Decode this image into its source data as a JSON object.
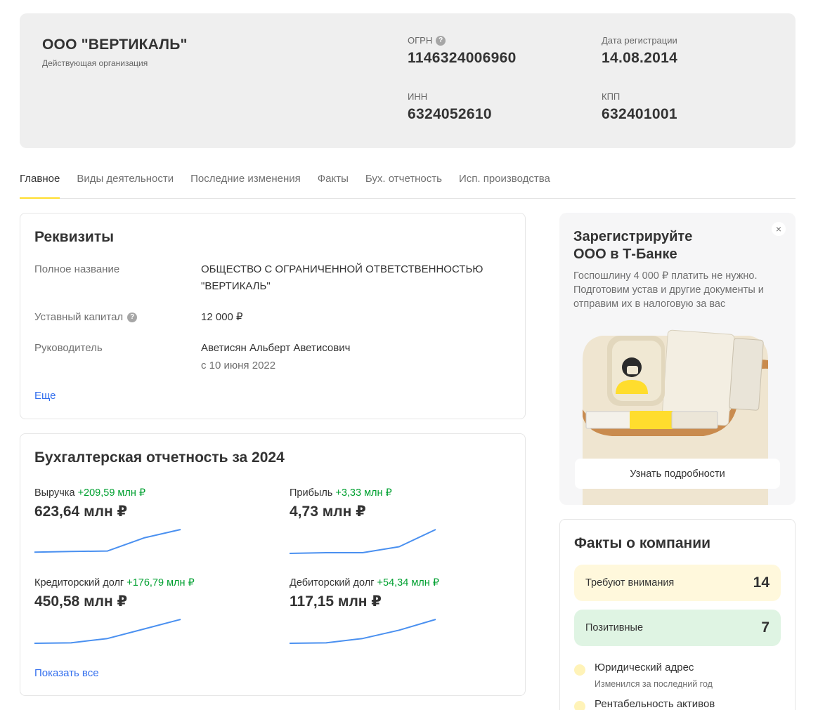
{
  "company": {
    "name": "ООО \"ВЕРТИКАЛЬ\"",
    "status": "Действующая организация",
    "ogrn_label": "ОГРН",
    "ogrn": "1146324006960",
    "reg_date_label": "Дата регистрации",
    "reg_date": "14.08.2014",
    "inn_label": "ИНН",
    "inn": "6324052610",
    "kpp_label": "КПП",
    "kpp": "632401001"
  },
  "tabs": [
    "Главное",
    "Виды деятельности",
    "Последние изменения",
    "Факты",
    "Бух. отчетность",
    "Исп. производства"
  ],
  "requisites": {
    "title": "Реквизиты",
    "full_name_label": "Полное название",
    "full_name_line1": "ОБЩЕСТВО С ОГРАНИЧЕННОЙ ОТВЕТСТВЕННОСТЬЮ",
    "full_name_line2": "\"ВЕРТИКАЛЬ\"",
    "capital_label": "Уставный капитал",
    "capital_value": "12 000 ₽",
    "director_label": "Руководитель",
    "director_name": "Аветисян Альберт Аветисович",
    "director_since": "с 10 июня 2022",
    "more_link": "Еще"
  },
  "accounting": {
    "title": "Бухгалтерская отчетность за 2024",
    "show_all": "Показать все",
    "metrics": [
      {
        "label": "Выручка",
        "delta": "+209,59 млн ₽",
        "value": "623,64 млн ₽",
        "trend": [
          0.05,
          0.08,
          0.1,
          0.65,
          1.0
        ]
      },
      {
        "label": "Прибыль",
        "delta": "+3,33 млн ₽",
        "value": "4,73 млн ₽",
        "trend": [
          0.0,
          0.03,
          0.03,
          0.28,
          1.0
        ]
      },
      {
        "label": "Кредиторский долг",
        "delta": "+176,79 млн ₽",
        "value": "450,58 млн ₽",
        "trend": [
          0.0,
          0.02,
          0.2,
          0.6,
          1.0
        ]
      },
      {
        "label": "Дебиторский долг",
        "delta": "+54,34 млн ₽",
        "value": "117,15 млн ₽",
        "trend": [
          0.0,
          0.02,
          0.2,
          0.55,
          1.0
        ]
      }
    ]
  },
  "promo": {
    "title_line1": "Зарегистрируйте",
    "title_line2": "ООО в Т-Банке",
    "text_line1": "Госпошлину 4 000 ₽ платить не нужно.",
    "text_line2": "Подготовим устав и другие документы и",
    "text_line3": "отправим их в налоговую за вас",
    "close": "×",
    "button": "Узнать подробности"
  },
  "facts": {
    "title": "Факты о компании",
    "attention_label": "Требуют внимания",
    "attention_count": "14",
    "positive_label": "Позитивные",
    "positive_count": "7",
    "items": [
      {
        "title": "Юридический адрес",
        "sub": "Изменился за последний год"
      },
      {
        "title": "Рентабельность активов",
        "sub": ""
      }
    ]
  },
  "colors": {
    "accent_yellow": "#ffdd2d",
    "link_blue": "#336fee",
    "delta_green": "#00a030",
    "chart_blue": "#4a90f0",
    "attention_bg": "#fff8dc",
    "positive_bg": "#dff4e3"
  }
}
